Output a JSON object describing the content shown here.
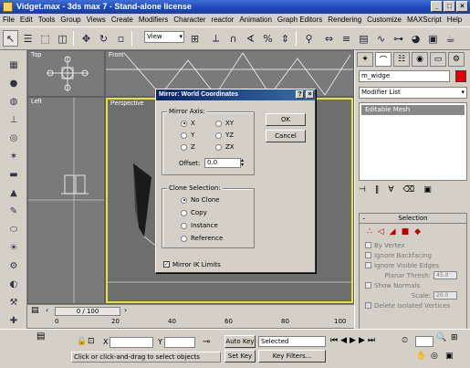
{
  "window": {
    "title": "Vidget.max - 3ds max 7 - Stand-alone license"
  },
  "menu": [
    "File",
    "Edit",
    "Tools",
    "Group",
    "Views",
    "Create",
    "Modifiers",
    "Character",
    "reactor",
    "Animation",
    "Graph Editors",
    "Rendering",
    "Customize",
    "MAXScript",
    "Help"
  ],
  "toolbar": {
    "view_select": "View"
  },
  "viewports": {
    "top": "Top",
    "front": "Front",
    "left": "Left",
    "perspective": "Perspective"
  },
  "command_panel": {
    "object_name": "m_widge",
    "modifier_list": "Modifier List",
    "stack_item": "Editable Mesh",
    "selection_rollout": {
      "title": "Selection",
      "by_vertex": "By Vertex",
      "ignore_backfacing": "Ignore Backfacing",
      "ignore_visible_edges": "Ignore Visible Edges",
      "planar_thresh_label": "Planar Thresh:",
      "planar_thresh_value": "45.0",
      "show_normals": "Show Normals",
      "scale_label": "Scale:",
      "scale_value": "20.0",
      "delete_isolated": "Delete Isolated Vertices"
    }
  },
  "dialog": {
    "title": "Mirror: World Coordinates",
    "mirror_axis_label": "Mirror Axis:",
    "axes": [
      "X",
      "Y",
      "Z",
      "XY",
      "YZ",
      "ZX"
    ],
    "offset_label": "Offset:",
    "offset_value": "0.0",
    "clone_label": "Clone Selection:",
    "clone_options": [
      "No Clone",
      "Copy",
      "Instance",
      "Reference"
    ],
    "mirror_ik": "Mirror IK Limits",
    "ok": "OK",
    "cancel": "Cancel"
  },
  "timeline": {
    "frame": "0 / 100",
    "ticks": [
      "0",
      "20",
      "40",
      "60",
      "80",
      "100"
    ]
  },
  "status": {
    "x_label": "X",
    "y_label": "Y",
    "auto_key": "Auto Key",
    "set_key": "Set Key",
    "selected": "Selected",
    "key_filters": "Key Filters...",
    "prompt": "Click or click-and-drag to select objects"
  }
}
